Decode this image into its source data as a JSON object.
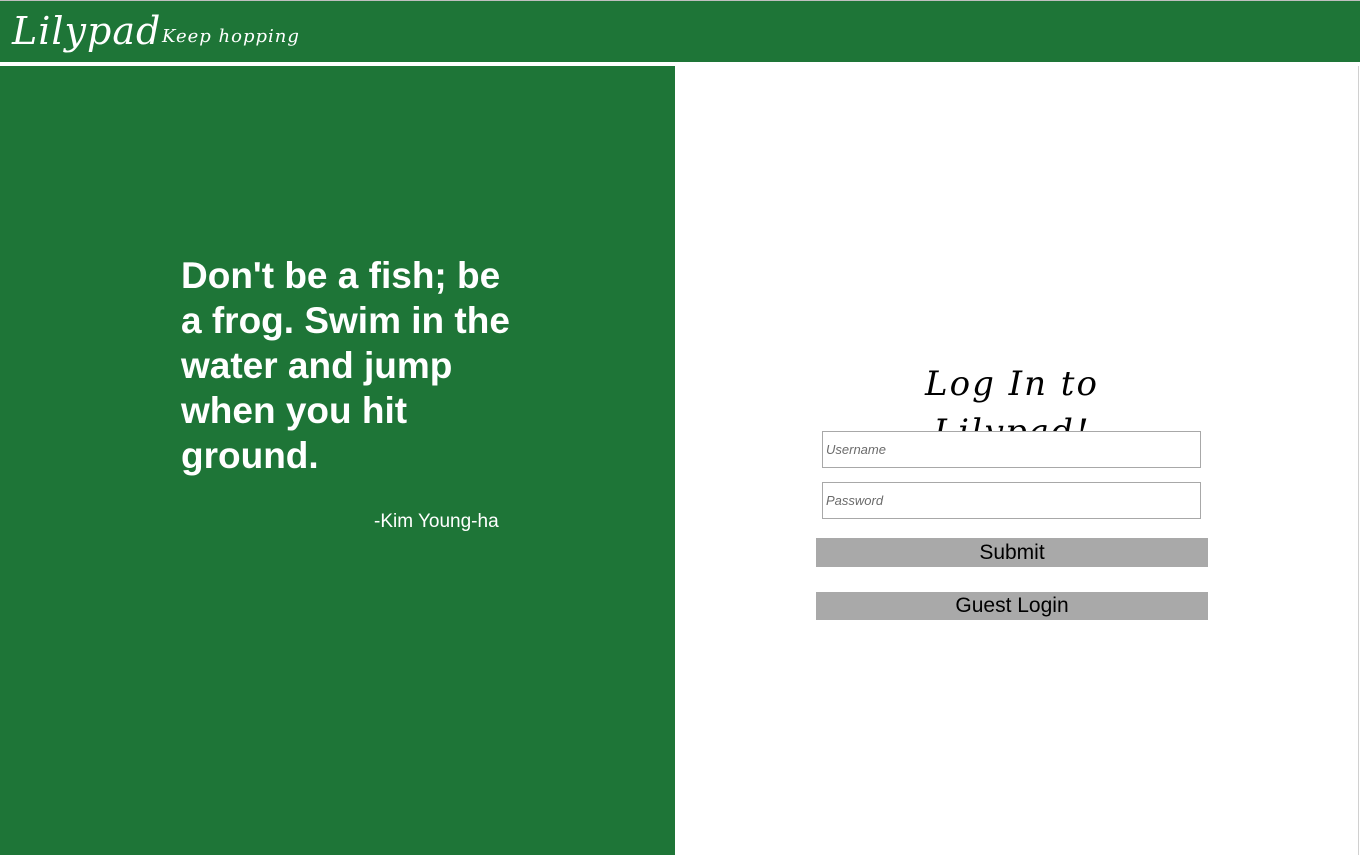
{
  "header": {
    "logo": "Lilypad",
    "tagline": "Keep hopping"
  },
  "quote": {
    "text": "Don't be a fish; be a frog. Swim in the water and jump when you hit ground.",
    "author": "-Kim Young-ha"
  },
  "login": {
    "title": "Log In to Lilypad!",
    "username_placeholder": "Username",
    "password_placeholder": "Password",
    "submit_label": "Submit",
    "guest_label": "Guest Login"
  },
  "colors": {
    "brand_green": "#1e7537",
    "button_gray": "#a9a9a9"
  }
}
